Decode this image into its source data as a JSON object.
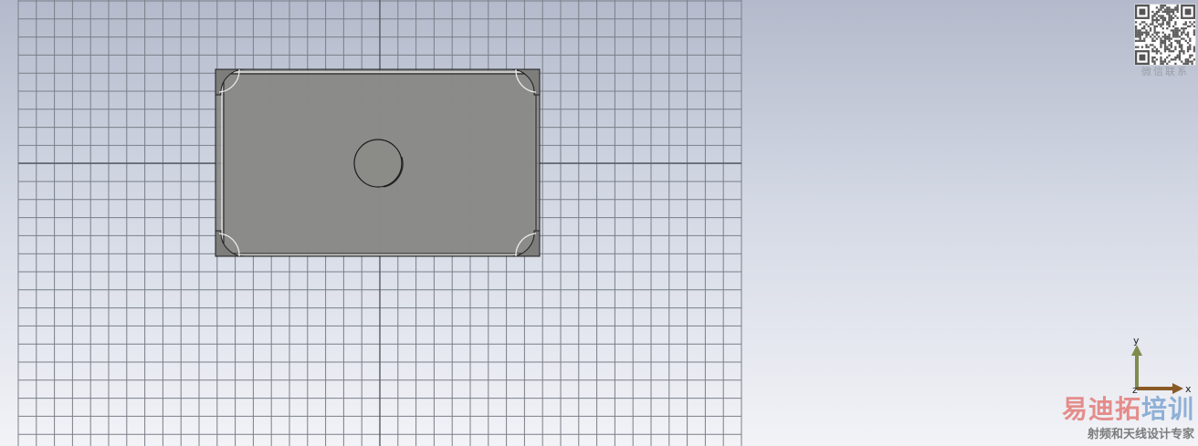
{
  "viewport": {
    "grid_color": "#7a7f88",
    "grid_minor_color": "#8c9099",
    "model_fill": "#8b8b88",
    "model_edge": "#1c1c1c"
  },
  "qr_code": {
    "caption": "微信联系",
    "icon": "qr-code-icon"
  },
  "axis_triad": {
    "y_label": "y",
    "x_label": "x",
    "z_label": "z",
    "y_color": "#7f8c4e",
    "x_color": "#8a5a26",
    "z_color": "#222222"
  },
  "watermark": {
    "title_part1": "易迪拓",
    "title_part2": "培训",
    "title_color1": "#e48d8b",
    "title_color2": "#8fb0d6",
    "subtitle": "射频和天线设计专家"
  }
}
